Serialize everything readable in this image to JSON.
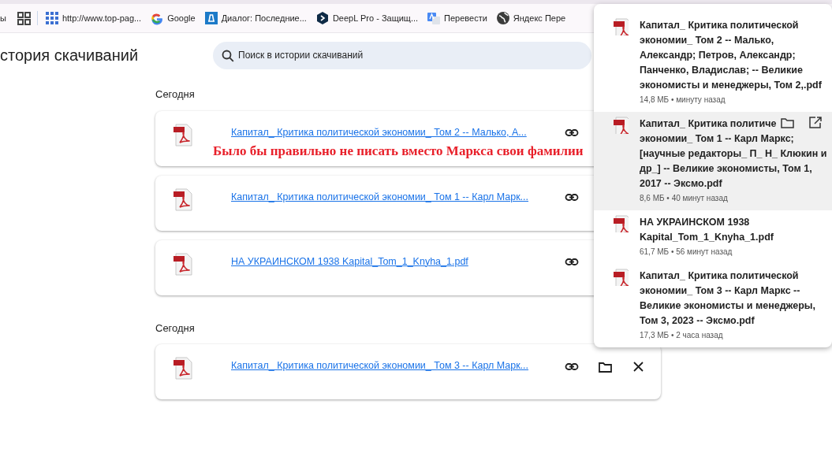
{
  "bookmarks_bar": {
    "items": [
      {
        "label": "ы",
        "kind": "cut"
      },
      {
        "kind": "apps"
      },
      {
        "label": "http://www.top-pag...",
        "kind": "grid"
      },
      {
        "label": "Google",
        "kind": "google"
      },
      {
        "label": "Диалог: Последние...",
        "kind": "dialog"
      },
      {
        "label": "DeepL Pro - Защищ...",
        "kind": "deepl"
      },
      {
        "label": "Перевести",
        "kind": "translate"
      },
      {
        "label": "Яндекс Пере",
        "kind": "globe"
      }
    ]
  },
  "page": {
    "title": "стория скачиваний",
    "search": {
      "placeholder": "Поиск в истории скачиваний"
    }
  },
  "groups": [
    {
      "heading": "Сегодня",
      "downloads": [
        {
          "file_name": "Капитал_ Критика политической экономии_ Том 2 -- Малько, А...",
          "annotation": "Было бы правильно не писать вместо Маркса свои фамилии"
        },
        {
          "file_name": "Капитал_ Критика политической экономии_ Том 1 -- Карл Марк..."
        },
        {
          "file_name": "НА УКРАИНСКОМ 1938 Kapital_Tom_1_Knyha_1.pdf"
        }
      ]
    },
    {
      "heading": "Сегодня",
      "downloads": [
        {
          "file_name": "Капитал_ Критика политической экономии_ Том 3 -- Карл Марк..."
        }
      ]
    }
  ],
  "downloads_popup": {
    "items": [
      {
        "title_lines": [
          "Капитал_ Критика политической",
          "экономии_ Том 2 -- Малько,",
          "Александр; Петров, Александр;",
          "Панченко, Владислав; -- Великие",
          "экономисты и менеджеры, Том 2,.pdf"
        ],
        "meta": "14,8 МБ • минуту назад",
        "hovered": false
      },
      {
        "title_lines": [
          "Капитал_ Критика политиче",
          "экономии_ Том 1 -- Карл Маркс;",
          "[научные редакторы_ П_ Н_ Клюкин и",
          "др_] -- Великие экономисты, Том 1,",
          "2017 -- Эксмо.pdf"
        ],
        "meta": "8,6 МБ • 40 минут назад",
        "hovered": true
      },
      {
        "title_lines": [
          "НА УКРАИНСКОМ  1938",
          "Kapital_Tom_1_Knyha_1.pdf"
        ],
        "meta": "61,7 МБ • 56 минут назад",
        "hovered": false
      },
      {
        "title_lines": [
          "Капитал_ Критика политической",
          "экономии_ Том 3 -- Карл Маркс --",
          "Великие экономисты и менеджеры,",
          "Том 3, 2023 -- Эксмо.pdf"
        ],
        "meta": "17,3 МБ • 2 часа назад",
        "hovered": false
      }
    ]
  }
}
